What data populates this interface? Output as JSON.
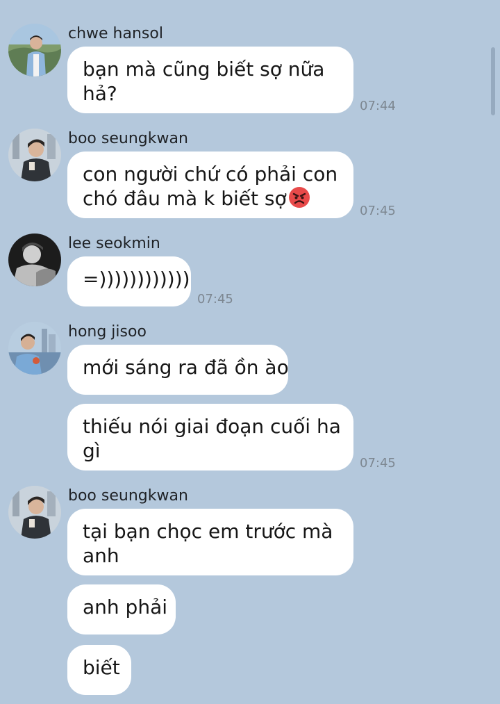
{
  "messages": [
    {
      "sender": "chwe hansol",
      "avatar": "avatar-hansol",
      "bubbles": [
        {
          "line1": "bạn mà cũng biết sợ nữa",
          "line2": "hả?"
        }
      ],
      "time": "07:44"
    },
    {
      "sender": "boo seungkwan",
      "avatar": "avatar-seungkwan",
      "bubbles": [
        {
          "line1": "con người chứ có phải con",
          "line2": "chó đâu mà k biết sợ",
          "emoji": "angry-face-icon"
        }
      ],
      "time": "07:45"
    },
    {
      "sender": "lee seokmin",
      "avatar": "avatar-seokmin",
      "bubbles": [
        {
          "line1": "=))))))))))))"
        }
      ],
      "time": "07:45"
    },
    {
      "sender": "hong jisoo",
      "avatar": "avatar-jisoo",
      "bubbles": [
        {
          "line1": "mới sáng ra đã ồn ào"
        },
        {
          "line1": "thiếu nói giai đoạn cuối ha",
          "line2": "gì"
        }
      ],
      "time": "07:45"
    },
    {
      "sender": "boo seungkwan",
      "avatar": "avatar-seungkwan",
      "bubbles": [
        {
          "line1": "tại bạn chọc em trước mà",
          "line2": "anh"
        },
        {
          "line1": "anh phải"
        },
        {
          "line1": "biết"
        }
      ]
    }
  ],
  "colors": {
    "background": "#b4c8dc",
    "bubble": "#ffffff",
    "timestamp": "#7d8791"
  }
}
